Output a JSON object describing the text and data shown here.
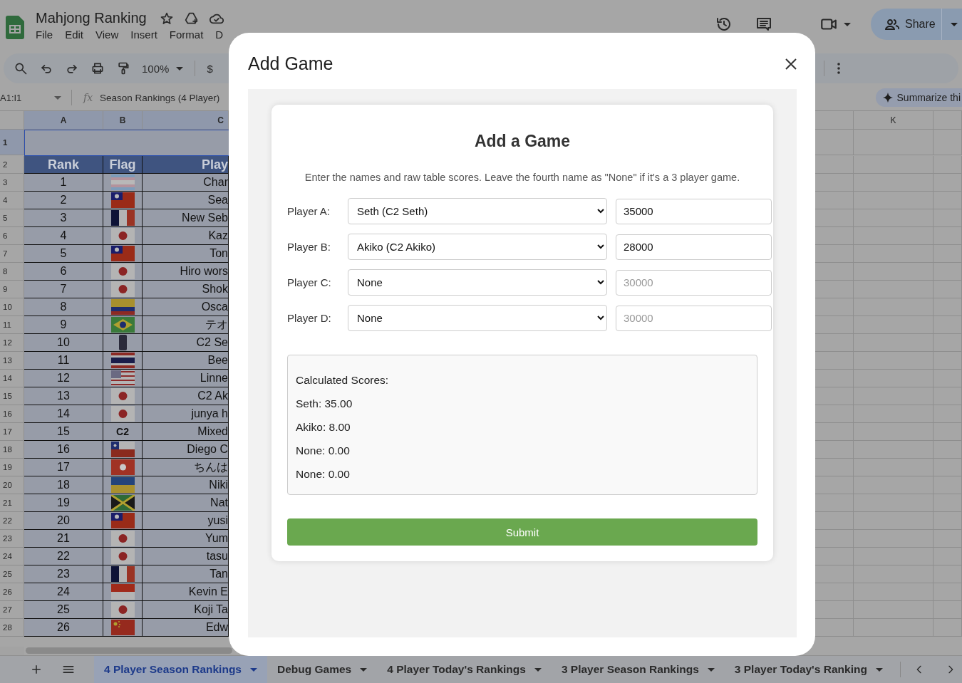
{
  "app": {
    "title": "Mahjong Ranking",
    "menus": [
      "File",
      "Edit",
      "View",
      "Insert",
      "Format",
      "D"
    ]
  },
  "toolbar": {
    "zoom": "100%",
    "currency": "$"
  },
  "share": {
    "label": "Share"
  },
  "formula_bar": {
    "name_box": "A1:I1",
    "fx": "fx",
    "formula": "Season Rankings (4 Player)"
  },
  "summarize": {
    "label": "Summarize thi"
  },
  "sheet": {
    "columns": [
      {
        "label": "A",
        "selected": true
      },
      {
        "label": "B",
        "selected": true
      },
      {
        "label": "C",
        "selected": true
      },
      {
        "label": "K",
        "selected": false
      }
    ],
    "title_row": {
      "row_number": "1"
    },
    "header_row": {
      "row_number": "2",
      "cells": [
        "Rank",
        "Flag",
        "Play"
      ]
    },
    "rows": [
      {
        "row_number": "3",
        "rank": "1",
        "flag": {
          "kind": "trans"
        },
        "player": "Char"
      },
      {
        "row_number": "4",
        "rank": "2",
        "flag": {
          "kind": "taiwan"
        },
        "player": "Sea"
      },
      {
        "row_number": "5",
        "rank": "3",
        "flag": {
          "kind": "france"
        },
        "player": "New Seb"
      },
      {
        "row_number": "6",
        "rank": "4",
        "flag": {
          "kind": "japan"
        },
        "player": "Kaz"
      },
      {
        "row_number": "7",
        "rank": "5",
        "flag": {
          "kind": "taiwan"
        },
        "player": "Ton"
      },
      {
        "row_number": "8",
        "rank": "6",
        "flag": {
          "kind": "japan"
        },
        "player": "Hiro wors"
      },
      {
        "row_number": "9",
        "rank": "7",
        "flag": {
          "kind": "japan"
        },
        "player": "Shok"
      },
      {
        "row_number": "10",
        "rank": "8",
        "flag": {
          "kind": "colombia"
        },
        "player": "Osca"
      },
      {
        "row_number": "11",
        "rank": "9",
        "flag": {
          "kind": "brazil"
        },
        "player": "テオ"
      },
      {
        "row_number": "12",
        "rank": "10",
        "flag": {
          "kind": "logo"
        },
        "player": "C2 Se"
      },
      {
        "row_number": "13",
        "rank": "11",
        "flag": {
          "kind": "thailand"
        },
        "player": "Bee"
      },
      {
        "row_number": "14",
        "rank": "12",
        "flag": {
          "kind": "usa"
        },
        "player": "Linne"
      },
      {
        "row_number": "15",
        "rank": "13",
        "flag": {
          "kind": "japan"
        },
        "player": "C2 Ak"
      },
      {
        "row_number": "16",
        "rank": "14",
        "flag": {
          "kind": "japan"
        },
        "player": "junya h"
      },
      {
        "row_number": "17",
        "rank": "15",
        "flag": {
          "kind": "text",
          "text": "C2"
        },
        "player": "Mixed"
      },
      {
        "row_number": "18",
        "rank": "16",
        "flag": {
          "kind": "chile"
        },
        "player": "Diego C"
      },
      {
        "row_number": "19",
        "rank": "17",
        "flag": {
          "kind": "hongkong"
        },
        "player": "ちんは"
      },
      {
        "row_number": "20",
        "rank": "18",
        "flag": {
          "kind": "ukraine"
        },
        "player": "Niki"
      },
      {
        "row_number": "21",
        "rank": "19",
        "flag": {
          "kind": "jamaica"
        },
        "player": "Nat"
      },
      {
        "row_number": "22",
        "rank": "20",
        "flag": {
          "kind": "taiwan"
        },
        "player": "yusi"
      },
      {
        "row_number": "23",
        "rank": "21",
        "flag": {
          "kind": "japan"
        },
        "player": "Yum"
      },
      {
        "row_number": "24",
        "rank": "22",
        "flag": {
          "kind": "japan"
        },
        "player": "tasu"
      },
      {
        "row_number": "25",
        "rank": "23",
        "flag": {
          "kind": "france"
        },
        "player": "Tan"
      },
      {
        "row_number": "26",
        "rank": "24",
        "flag": {
          "kind": "redwhite"
        },
        "player": "Kevin E"
      },
      {
        "row_number": "27",
        "rank": "25",
        "flag": {
          "kind": "japan"
        },
        "player": "Koji Ta"
      },
      {
        "row_number": "28",
        "rank": "26",
        "flag": {
          "kind": "china"
        },
        "player": "Edw"
      }
    ]
  },
  "dialog": {
    "title": "Add Game",
    "heading": "Add a Game",
    "description": "Enter the names and raw table scores. Leave the fourth name as \"None\" if it's a 3 player game.",
    "players": [
      {
        "label": "Player A:",
        "selection": "Seth (C2 Seth)",
        "score": "35000"
      },
      {
        "label": "Player B:",
        "selection": "Akiko (C2 Akiko)",
        "score": "28000"
      },
      {
        "label": "Player C:",
        "selection": "None",
        "placeholder": "30000"
      },
      {
        "label": "Player D:",
        "selection": "None",
        "placeholder": "30000"
      }
    ],
    "scores_title": "Calculated Scores:",
    "scores": [
      "Seth: 35.00",
      "Akiko: 8.00",
      "None: 0.00",
      "None: 0.00"
    ],
    "submit": "Submit"
  },
  "sheet_tabs": [
    {
      "label": "4 Player Season Rankings",
      "selected": true
    },
    {
      "label": "Debug Games",
      "selected": false
    },
    {
      "label": "4 Player Today's Rankings",
      "selected": false
    },
    {
      "label": "3 Player Season Rankings",
      "selected": false
    },
    {
      "label": "3 Player Today's Ranking",
      "selected": false
    }
  ]
}
